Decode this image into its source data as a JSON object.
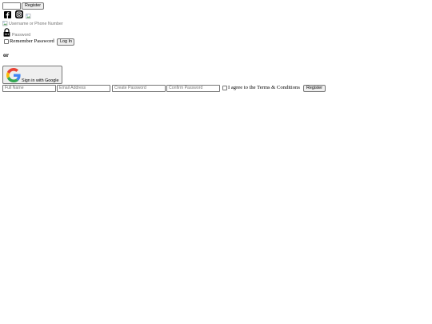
{
  "header": {
    "search_value": "",
    "register_label": "Register"
  },
  "social": {
    "icons": [
      "facebook-icon",
      "instagram-icon",
      "broken-image-icon"
    ]
  },
  "login": {
    "username_placeholder": "Username or Phone Number",
    "password_placeholder": "Password",
    "remember_label": "Remember Password",
    "login_button": "Log In"
  },
  "divider": {
    "or_label": "or"
  },
  "google": {
    "label": "Sign in with Google",
    "colors": {
      "blue": "#4285F4",
      "red": "#EA4335",
      "yellow": "#FBBC05",
      "green": "#34A853"
    }
  },
  "signup": {
    "full_name_placeholder": "Full Name",
    "email_placeholder": "Email Address",
    "create_password_placeholder": "Create Password",
    "confirm_password_placeholder": "Confirm Password",
    "terms_label": "I agree to the Terms & Conditions",
    "register_button": "Register"
  }
}
